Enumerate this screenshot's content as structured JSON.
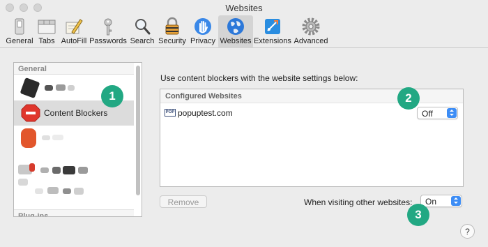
{
  "window": {
    "title": "Websites"
  },
  "toolbar": {
    "items": [
      {
        "label": "General",
        "icon": "switch-icon"
      },
      {
        "label": "Tabs",
        "icon": "tabs-icon"
      },
      {
        "label": "AutoFill",
        "icon": "pencil-icon"
      },
      {
        "label": "Passwords",
        "icon": "key-icon"
      },
      {
        "label": "Search",
        "icon": "magnifier-icon"
      },
      {
        "label": "Security",
        "icon": "padlock-icon"
      },
      {
        "label": "Privacy",
        "icon": "hand-icon"
      },
      {
        "label": "Websites",
        "icon": "globe-icon",
        "active": true
      },
      {
        "label": "Extensions",
        "icon": "puzzle-icon"
      },
      {
        "label": "Advanced",
        "icon": "gear-icon"
      }
    ]
  },
  "sidebar": {
    "section_general": "General",
    "selected_item": "Content Blockers",
    "section_plugins": "Plug-ins"
  },
  "main": {
    "instruction": "Use content blockers with the website settings below:",
    "table_header": "Configured Websites",
    "rows": [
      {
        "site": "popuptest.com",
        "icon_text": "POP",
        "value": "Off"
      }
    ],
    "remove_label": "Remove",
    "other_label": "When visiting other websites:",
    "other_value": "On",
    "help_label": "?"
  },
  "callouts": [
    "1",
    "2",
    "3"
  ],
  "colors": {
    "callout": "#22a883",
    "stepper": "#3d8df5",
    "selection": "#dcdcdc"
  }
}
